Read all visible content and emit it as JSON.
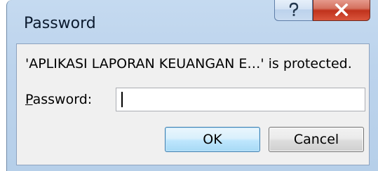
{
  "dialog": {
    "title": "Password",
    "help_icon": "question-mark-icon",
    "close_icon": "close-x-icon",
    "message": "'APLIKASI LAPORAN KEUANGAN E…' is protected.",
    "password_label_mnemonic": "P",
    "password_label_rest": "assword:",
    "password_value": "",
    "ok_label": "OK",
    "cancel_label": "Cancel"
  },
  "colors": {
    "titlebar": "#bcd3ec",
    "client_bg": "#f0f0f0",
    "close_button": "#c0321c",
    "default_button_border": "#3c7fb1"
  }
}
